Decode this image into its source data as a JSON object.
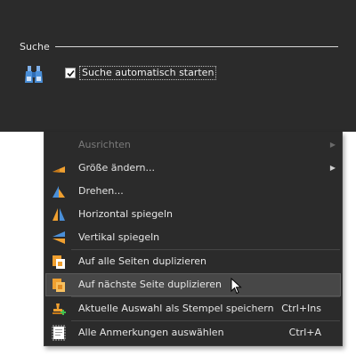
{
  "preferences": {
    "section_title": "Suche",
    "checkbox_label": "Suche automatisch starten",
    "checkbox_checked": true
  },
  "menu": {
    "items": [
      {
        "label": "Ausrichten",
        "shortcut": "",
        "submenu": true,
        "enabled": false,
        "icon": "none"
      },
      {
        "label": "Größe ändern...",
        "shortcut": "",
        "submenu": true,
        "enabled": true,
        "icon": "resize-icon"
      },
      {
        "label": "Drehen...",
        "shortcut": "",
        "submenu": false,
        "enabled": true,
        "icon": "rotate-icon"
      },
      {
        "label": "Horizontal spiegeln",
        "shortcut": "",
        "submenu": false,
        "enabled": true,
        "icon": "flip-horizontal-icon"
      },
      {
        "label": "Vertikal spiegeln",
        "shortcut": "",
        "submenu": false,
        "enabled": true,
        "icon": "flip-vertical-icon"
      },
      {
        "label": "Auf alle Seiten duplizieren",
        "shortcut": "",
        "submenu": false,
        "enabled": true,
        "icon": "duplicate-all-pages-icon"
      },
      {
        "label": "Auf nächste Seite duplizieren",
        "shortcut": "",
        "submenu": false,
        "enabled": true,
        "hovered": true,
        "icon": "duplicate-next-page-icon"
      },
      {
        "label": "Aktuelle Auswahl als Stempel speichern",
        "shortcut": "Ctrl+Ins",
        "submenu": false,
        "enabled": true,
        "icon": "save-stamp-icon"
      },
      {
        "label": "Alle Anmerkungen auswählen",
        "shortcut": "Ctrl+A",
        "submenu": false,
        "enabled": true,
        "icon": "select-all-annotations-icon"
      }
    ],
    "submenu_arrow": "▶"
  },
  "colors": {
    "panel_bg": "#2b2b2b",
    "hover_bg": "#474747",
    "accent_orange": "#f0a030",
    "accent_blue": "#4a8fd8"
  }
}
